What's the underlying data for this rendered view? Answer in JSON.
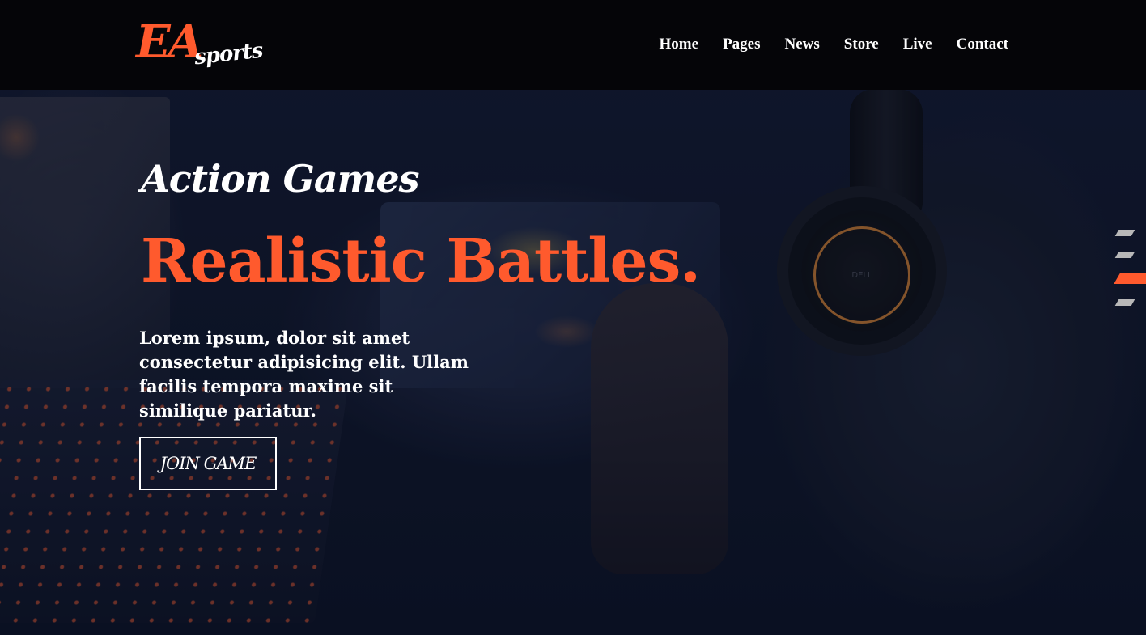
{
  "brand": {
    "logo_main": "EA",
    "logo_sub": "sports",
    "accent_color": "#ff5a2d"
  },
  "nav": {
    "items": [
      {
        "label": "Home"
      },
      {
        "label": "Pages"
      },
      {
        "label": "News"
      },
      {
        "label": "Store"
      },
      {
        "label": "Live"
      },
      {
        "label": "Contact"
      }
    ]
  },
  "hero": {
    "subtitle": "Action Games",
    "headline": "Realistic Battles.",
    "description": "Lorem ipsum, dolor sit amet consectetur adipisicing elit. Ullam facilis tempora maxime sit similique pariatur.",
    "cta_label": "JOIN GAME",
    "headphone_brand": "DELL"
  },
  "slider": {
    "count": 4,
    "active_index": 2
  }
}
